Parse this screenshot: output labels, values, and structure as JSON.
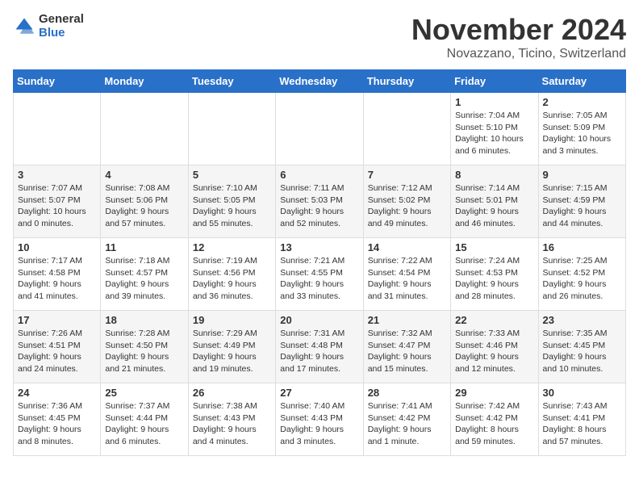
{
  "header": {
    "logo_general": "General",
    "logo_blue": "Blue",
    "month_title": "November 2024",
    "location": "Novazzano, Ticino, Switzerland"
  },
  "days_of_week": [
    "Sunday",
    "Monday",
    "Tuesday",
    "Wednesday",
    "Thursday",
    "Friday",
    "Saturday"
  ],
  "weeks": [
    [
      {
        "day": "",
        "info": ""
      },
      {
        "day": "",
        "info": ""
      },
      {
        "day": "",
        "info": ""
      },
      {
        "day": "",
        "info": ""
      },
      {
        "day": "",
        "info": ""
      },
      {
        "day": "1",
        "info": "Sunrise: 7:04 AM\nSunset: 5:10 PM\nDaylight: 10 hours and 6 minutes."
      },
      {
        "day": "2",
        "info": "Sunrise: 7:05 AM\nSunset: 5:09 PM\nDaylight: 10 hours and 3 minutes."
      }
    ],
    [
      {
        "day": "3",
        "info": "Sunrise: 7:07 AM\nSunset: 5:07 PM\nDaylight: 10 hours and 0 minutes."
      },
      {
        "day": "4",
        "info": "Sunrise: 7:08 AM\nSunset: 5:06 PM\nDaylight: 9 hours and 57 minutes."
      },
      {
        "day": "5",
        "info": "Sunrise: 7:10 AM\nSunset: 5:05 PM\nDaylight: 9 hours and 55 minutes."
      },
      {
        "day": "6",
        "info": "Sunrise: 7:11 AM\nSunset: 5:03 PM\nDaylight: 9 hours and 52 minutes."
      },
      {
        "day": "7",
        "info": "Sunrise: 7:12 AM\nSunset: 5:02 PM\nDaylight: 9 hours and 49 minutes."
      },
      {
        "day": "8",
        "info": "Sunrise: 7:14 AM\nSunset: 5:01 PM\nDaylight: 9 hours and 46 minutes."
      },
      {
        "day": "9",
        "info": "Sunrise: 7:15 AM\nSunset: 4:59 PM\nDaylight: 9 hours and 44 minutes."
      }
    ],
    [
      {
        "day": "10",
        "info": "Sunrise: 7:17 AM\nSunset: 4:58 PM\nDaylight: 9 hours and 41 minutes."
      },
      {
        "day": "11",
        "info": "Sunrise: 7:18 AM\nSunset: 4:57 PM\nDaylight: 9 hours and 39 minutes."
      },
      {
        "day": "12",
        "info": "Sunrise: 7:19 AM\nSunset: 4:56 PM\nDaylight: 9 hours and 36 minutes."
      },
      {
        "day": "13",
        "info": "Sunrise: 7:21 AM\nSunset: 4:55 PM\nDaylight: 9 hours and 33 minutes."
      },
      {
        "day": "14",
        "info": "Sunrise: 7:22 AM\nSunset: 4:54 PM\nDaylight: 9 hours and 31 minutes."
      },
      {
        "day": "15",
        "info": "Sunrise: 7:24 AM\nSunset: 4:53 PM\nDaylight: 9 hours and 28 minutes."
      },
      {
        "day": "16",
        "info": "Sunrise: 7:25 AM\nSunset: 4:52 PM\nDaylight: 9 hours and 26 minutes."
      }
    ],
    [
      {
        "day": "17",
        "info": "Sunrise: 7:26 AM\nSunset: 4:51 PM\nDaylight: 9 hours and 24 minutes."
      },
      {
        "day": "18",
        "info": "Sunrise: 7:28 AM\nSunset: 4:50 PM\nDaylight: 9 hours and 21 minutes."
      },
      {
        "day": "19",
        "info": "Sunrise: 7:29 AM\nSunset: 4:49 PM\nDaylight: 9 hours and 19 minutes."
      },
      {
        "day": "20",
        "info": "Sunrise: 7:31 AM\nSunset: 4:48 PM\nDaylight: 9 hours and 17 minutes."
      },
      {
        "day": "21",
        "info": "Sunrise: 7:32 AM\nSunset: 4:47 PM\nDaylight: 9 hours and 15 minutes."
      },
      {
        "day": "22",
        "info": "Sunrise: 7:33 AM\nSunset: 4:46 PM\nDaylight: 9 hours and 12 minutes."
      },
      {
        "day": "23",
        "info": "Sunrise: 7:35 AM\nSunset: 4:45 PM\nDaylight: 9 hours and 10 minutes."
      }
    ],
    [
      {
        "day": "24",
        "info": "Sunrise: 7:36 AM\nSunset: 4:45 PM\nDaylight: 9 hours and 8 minutes."
      },
      {
        "day": "25",
        "info": "Sunrise: 7:37 AM\nSunset: 4:44 PM\nDaylight: 9 hours and 6 minutes."
      },
      {
        "day": "26",
        "info": "Sunrise: 7:38 AM\nSunset: 4:43 PM\nDaylight: 9 hours and 4 minutes."
      },
      {
        "day": "27",
        "info": "Sunrise: 7:40 AM\nSunset: 4:43 PM\nDaylight: 9 hours and 3 minutes."
      },
      {
        "day": "28",
        "info": "Sunrise: 7:41 AM\nSunset: 4:42 PM\nDaylight: 9 hours and 1 minute."
      },
      {
        "day": "29",
        "info": "Sunrise: 7:42 AM\nSunset: 4:42 PM\nDaylight: 8 hours and 59 minutes."
      },
      {
        "day": "30",
        "info": "Sunrise: 7:43 AM\nSunset: 4:41 PM\nDaylight: 8 hours and 57 minutes."
      }
    ]
  ]
}
